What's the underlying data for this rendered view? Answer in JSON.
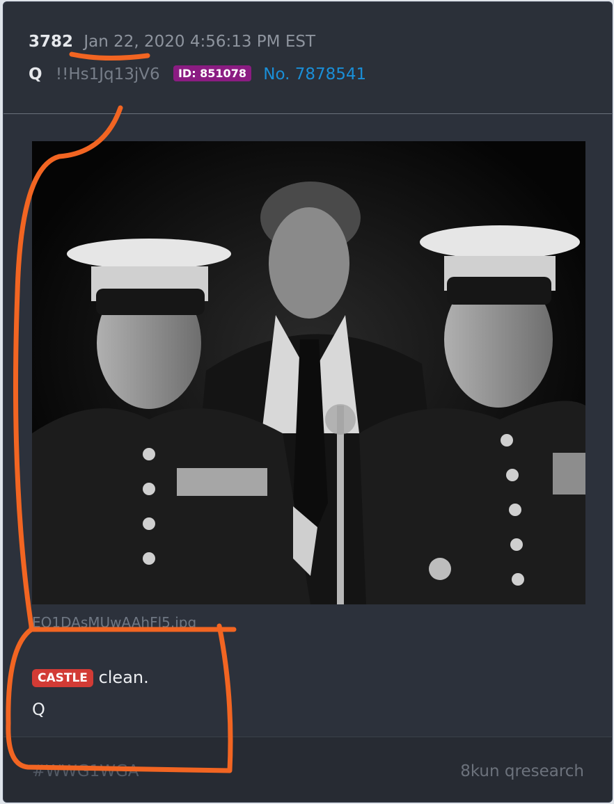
{
  "post": {
    "number": "3782",
    "date": "Jan 22, 2020 4:56:13 PM EST",
    "author": "Q",
    "tripcode": "!!Hs1Jq13jV6",
    "id_badge": "ID: 851078",
    "post_no": "No. 7878541"
  },
  "image": {
    "filename": "EO1DAsMUwAAhFl5.jpg",
    "description_icon": "photo-icon"
  },
  "body": {
    "tag": "CASTLE",
    "text": "clean.",
    "signature": "Q"
  },
  "footer": {
    "hashtag": "#WWG1WGA",
    "source": "8kun qresearch"
  },
  "colors": {
    "card_bg": "#2c313b",
    "id_badge": "#8b1c82",
    "link": "#1a8fd8",
    "castle_tag": "#d23b35",
    "annotation": "#f26522"
  }
}
